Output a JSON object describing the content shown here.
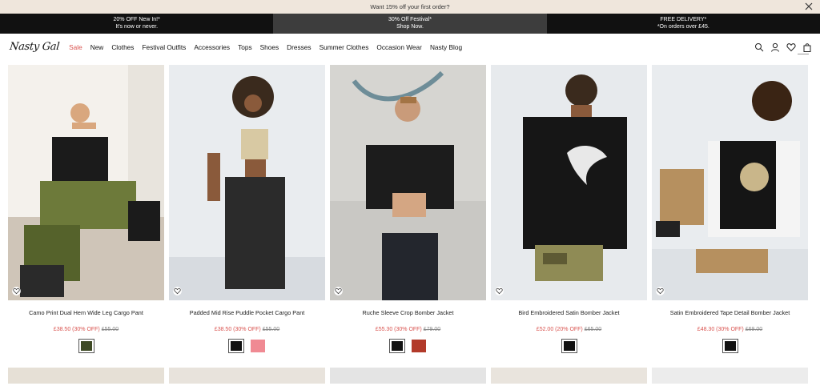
{
  "announcement": {
    "text": "Want 15% off your first order?"
  },
  "promos": [
    {
      "line1": "20% OFF New In!*",
      "line2": "It's now or never."
    },
    {
      "line1": "30% Off Festival*",
      "line2": "Shop Now."
    },
    {
      "line1": "FREE DELIVERY*",
      "line2": "*On orders over £45."
    }
  ],
  "nav": {
    "logo": "Nasty Gal",
    "items": [
      "Sale",
      "New",
      "Clothes",
      "Festival Outfits",
      "Accessories",
      "Tops",
      "Shoes",
      "Dresses",
      "Summer Clothes",
      "Occasion Wear",
      "Nasty Blog"
    ]
  },
  "products": [
    {
      "name": "Camo Print Dual Hem Wide Leg Cargo Pant",
      "price": "£38.50 (30% OFF)",
      "was": "£55.00",
      "swatches": [
        "#3e4a25"
      ]
    },
    {
      "name": "Padded Mid Rise Puddle Pocket Cargo Pant",
      "price": "£38.50 (30% OFF)",
      "was": "£55.00",
      "swatches": [
        "#111111",
        "#f08a93"
      ]
    },
    {
      "name": "Ruche Sleeve Crop Bomber Jacket",
      "price": "£55.30 (30% OFF)",
      "was": "£79.00",
      "swatches": [
        "#111111",
        "#b23a2a"
      ]
    },
    {
      "name": "Bird Embroidered Satin Bomber Jacket",
      "price": "£52.00 (20% OFF)",
      "was": "£65.00",
      "swatches": [
        "#111111"
      ]
    },
    {
      "name": "Satin Embroidered Tape Detail Bomber Jacket",
      "price": "£48.30 (30% OFF)",
      "was": "£69.00",
      "swatches": [
        "#111111"
      ]
    }
  ],
  "colors": {
    "accent": "#d9534f",
    "announcement_bg": "#efe6dc",
    "promo_bg": "#111111",
    "promo_mid_bg": "#3d3d3d"
  }
}
